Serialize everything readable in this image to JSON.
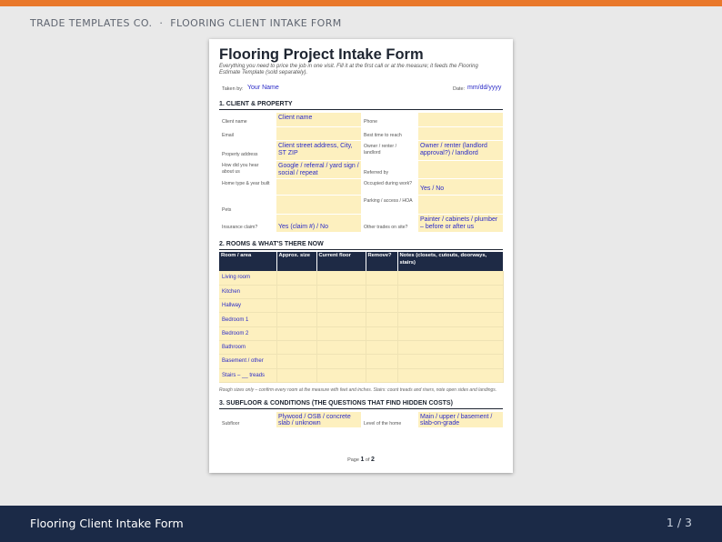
{
  "header": {
    "brand": "TRADE TEMPLATES CO.",
    "separator": "·",
    "title": "FLOORING CLIENT INTAKE FORM"
  },
  "footer": {
    "title": "Flooring Client Intake Form",
    "page_indicator": "1 / 3"
  },
  "document": {
    "title": "Flooring Project Intake Form",
    "subtitle": "Everything you need to price the job in one visit. Fill it at the first call or at the measure; it feeds the Flooring Estimate Template (sold separately).",
    "taken_by_label": "Taken by:",
    "taken_by_value": "Your Name",
    "date_label": "Date:",
    "date_value": "mm/dd/yyyy",
    "section1": {
      "title": "1. CLIENT & PROPERTY",
      "client_name_label": "Client name",
      "client_name_value": "Client name",
      "phone_label": "Phone",
      "email_label": "Email",
      "best_time_label": "Best time to reach",
      "property_address_label": "Property address",
      "property_address_value": "Client street address, City, ST ZIP",
      "owner_label": "Owner / renter / landlord",
      "owner_value": "Owner / renter (landlord approval?) / landlord",
      "heard_label": "How did you hear about us",
      "heard_value": "Google / referral / yard sign / social / repeat",
      "referred_label": "Referred by",
      "home_type_label": "Home type & year built",
      "occupied_label": "Occupied during work?",
      "occupied_value": "Yes / No",
      "pets_label": "Pets",
      "parking_label": "Parking / access / HOA",
      "insurance_label": "Insurance claim?",
      "insurance_value": "Yes (claim #) / No",
      "other_trades_label": "Other trades on site?",
      "other_trades_value": "Painter / cabinets / plumber – before or after us"
    },
    "section2": {
      "title": "2. ROOMS & WHAT'S THERE NOW",
      "columns": [
        "Room / area",
        "Approx. size",
        "Current floor",
        "Remove?",
        "Notes (closets, cutouts, doorways, stairs)"
      ],
      "rooms": [
        "Living room",
        "Kitchen",
        "Hallway",
        "Bedroom 1",
        "Bedroom 2",
        "Bathroom",
        "Basement / other",
        "Stairs – __ treads"
      ],
      "note": "Rough sizes only – confirm every room at the measure with feet and inches. Stairs: count treads and risers, note open sides and landings."
    },
    "section3": {
      "title": "3. SUBFLOOR & CONDITIONS (THE QUESTIONS THAT FIND HIDDEN COSTS)",
      "subfloor_label": "Subfloor",
      "subfloor_value": "Plywood / OSB / concrete slab / unknown",
      "level_label": "Level of the home",
      "level_value": "Main / upper / basement / slab-on-grade"
    },
    "page": {
      "prefix": "Page",
      "current": "1",
      "of": "of",
      "total": "2"
    }
  }
}
